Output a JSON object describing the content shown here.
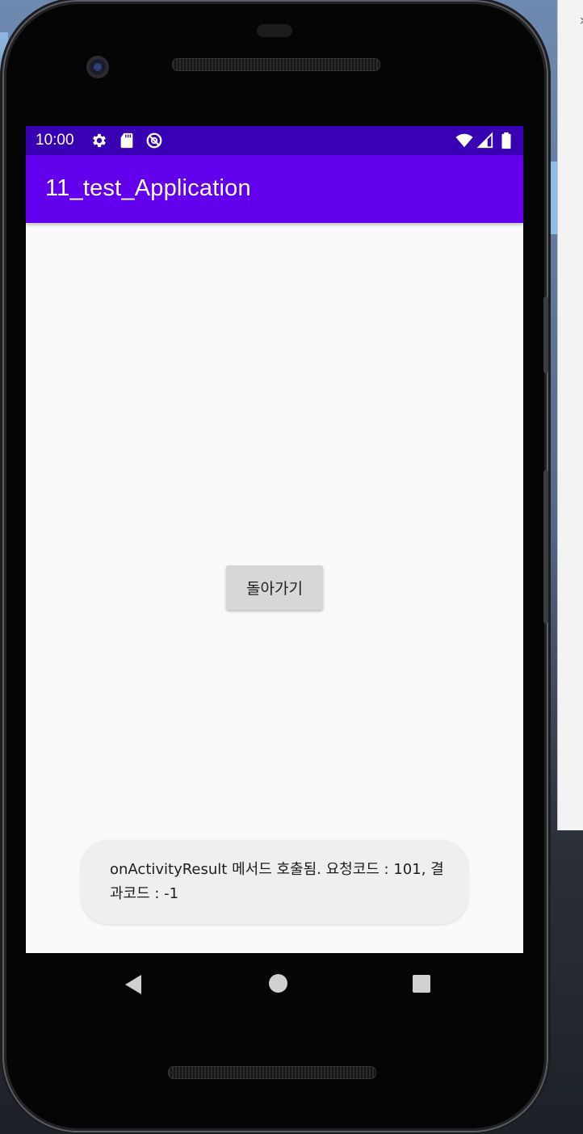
{
  "status_bar": {
    "time": "10:00",
    "left_icons": [
      "settings-gear-icon",
      "sd-card-icon",
      "do-not-disturb-icon"
    ],
    "right_icons": [
      "wifi-icon",
      "cell-signal-icon",
      "battery-icon"
    ]
  },
  "app": {
    "title": "11_test_Application",
    "bar_color": "#6200ee",
    "status_color": "#3700b3"
  },
  "main": {
    "back_button_label": "돌아가기"
  },
  "toast": {
    "message": "onActivityResult 메서드 호출됨. 요청코드 : 101, 결과코드 : -1"
  },
  "navigation": {
    "buttons": [
      "back-triangle-icon",
      "home-circle-icon",
      "recents-square-icon"
    ]
  }
}
